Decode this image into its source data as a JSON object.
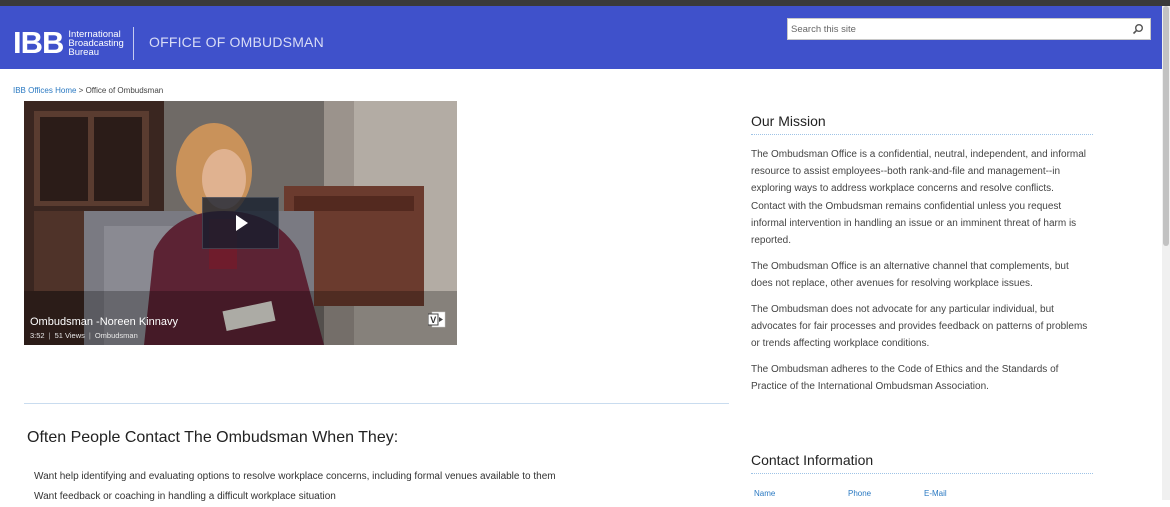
{
  "header": {
    "logo_mark": "IBB",
    "logo_lines": [
      "International",
      "Broadcasting",
      "Bureau"
    ],
    "site_title": "OFFICE OF OMBUDSMAN",
    "brand_color": "#3f51cb"
  },
  "search": {
    "placeholder": "Search this site",
    "icon": "search-icon"
  },
  "breadcrumb": {
    "home": "IBB Offices Home",
    "separator": " > ",
    "current": "Office of Ombudsman"
  },
  "video": {
    "title": "Ombudsman -Noreen Kinnavy",
    "duration": "3:52",
    "views": "51 Views",
    "channel": "Ombudsman",
    "play_icon": "play-icon",
    "badge_icon": "office-video-icon"
  },
  "left": {
    "heading": "Often People Contact The Ombudsman When They:",
    "items": [
      "Want help identifying and evaluating options to resolve workplace concerns, including formal venues available to them",
      "Want feedback or coaching in handling a difficult workplace situation"
    ]
  },
  "mission": {
    "title": "Our Mission",
    "paragraphs": [
      "The Ombudsman Office is a confidential, neutral, independent, and informal resource to assist employees--both rank-and-file and management--in exploring ways to address workplace concerns and resolve conflicts. Contact with the Ombudsman remains confidential unless you request informal intervention in handling an issue or an imminent threat of harm is reported.",
      "The Ombudsman Office is an alternative channel that complements, but does not replace, other avenues for resolving workplace issues.",
      "The  Ombudsman does not advocate for any particular individual, but advocates for fair processes and provides feedback on patterns of problems or trends affecting workplace conditions.",
      "The Ombudsman adheres to the Code of Ethics and the Standards of Practice of the International Ombudsman Association."
    ]
  },
  "contact": {
    "title": "Contact Information",
    "columns": [
      "Name",
      "Phone",
      "E-Mail"
    ]
  }
}
